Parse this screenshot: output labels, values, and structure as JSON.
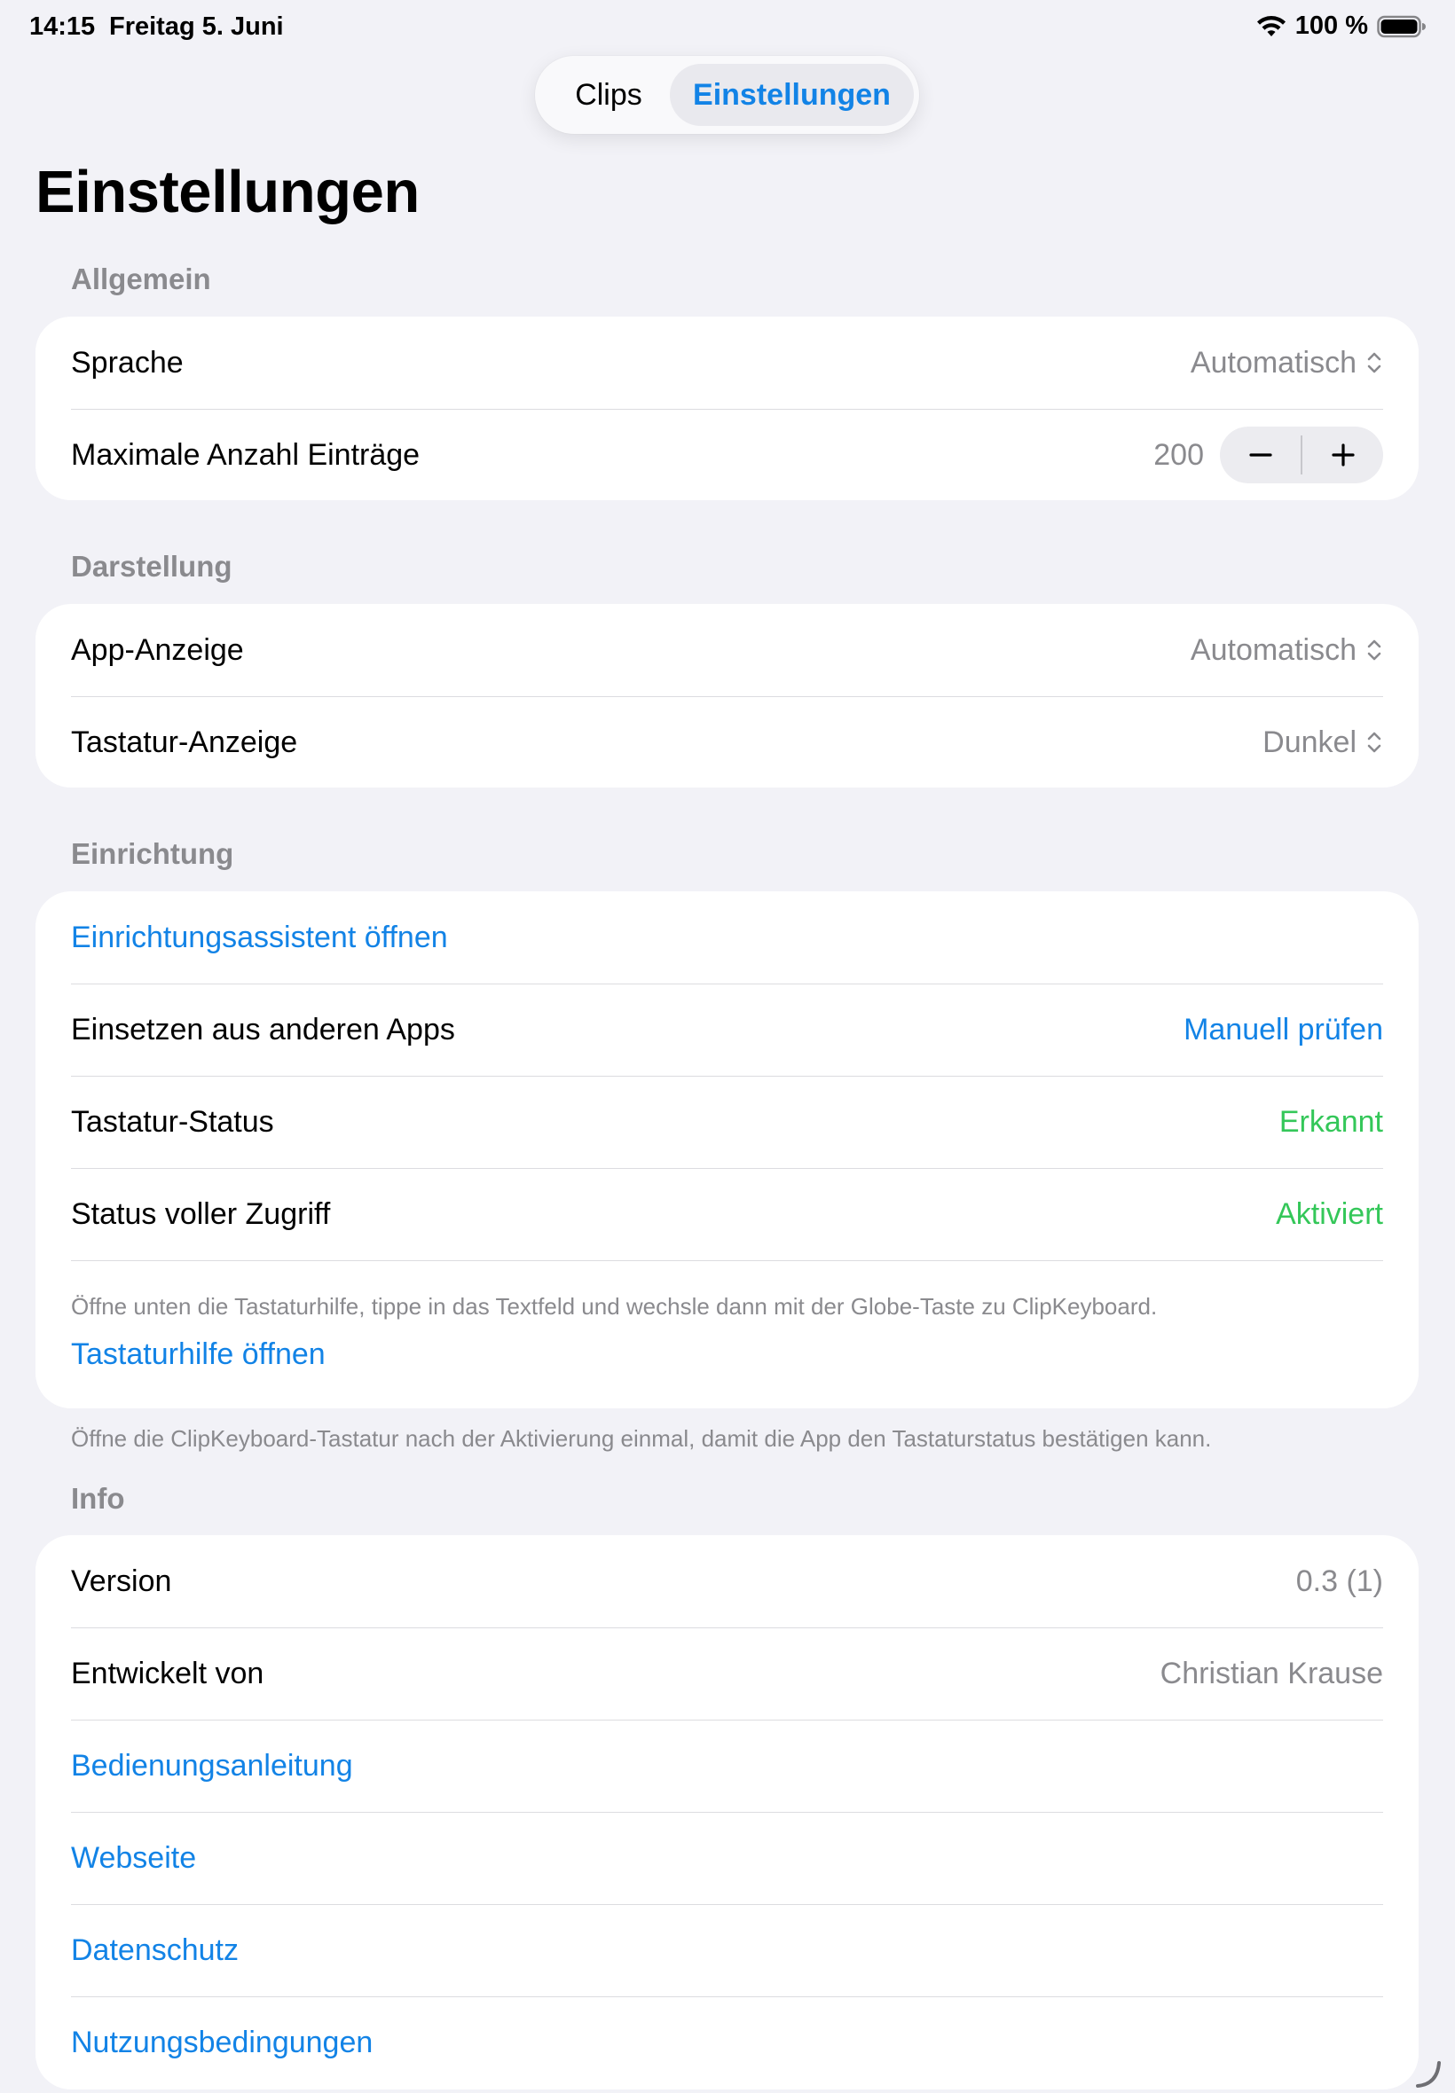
{
  "status_bar": {
    "time": "14:15",
    "date": "Freitag 5. Juni",
    "battery_text": "100 %",
    "battery_level_percent": 100,
    "icons": [
      "wifi-icon",
      "battery-icon"
    ]
  },
  "segmented_control": {
    "items": [
      "Clips",
      "Einstellungen"
    ],
    "selected": "Einstellungen"
  },
  "page": {
    "title": "Einstellungen"
  },
  "sections": {
    "allgemein": {
      "header": "Allgemein",
      "rows": {
        "sprache": {
          "label": "Sprache",
          "value": "Automatisch"
        },
        "max_entries": {
          "label": "Maximale Anzahl Einträge",
          "value": "200"
        }
      }
    },
    "darstellung": {
      "header": "Darstellung",
      "rows": {
        "app_anzeige": {
          "label": "App-Anzeige",
          "value": "Automatisch"
        },
        "tastatur_anzeige": {
          "label": "Tastatur-Anzeige",
          "value": "Dunkel"
        }
      }
    },
    "einrichtung": {
      "header": "Einrichtung",
      "rows": {
        "assistant": {
          "label": "Einrichtungsassistent öffnen"
        },
        "paste": {
          "label": "Einsetzen aus anderen Apps",
          "value": "Manuell prüfen"
        },
        "keyboard_status": {
          "label": "Tastatur-Status",
          "value": "Erkannt"
        },
        "full_access": {
          "label": "Status voller Zugriff",
          "value": "Aktiviert"
        }
      },
      "hint": "Öffne unten die Tastaturhilfe, tippe in das Textfeld und wechsle dann mit der Globe-Taste zu ClipKeyboard.",
      "help_link": "Tastaturhilfe öffnen",
      "footer": "Öffne die ClipKeyboard-Tastatur nach der Aktivierung einmal, damit die App den Tastaturstatus bestätigen kann."
    },
    "info": {
      "header": "Info",
      "rows": {
        "version": {
          "label": "Version",
          "value": "0.3 (1)"
        },
        "developer": {
          "label": "Entwickelt von",
          "value": "Christian Krause"
        },
        "manual": {
          "label": "Bedienungsanleitung"
        },
        "website": {
          "label": "Webseite"
        },
        "privacy": {
          "label": "Datenschutz"
        },
        "terms": {
          "label": "Nutzungsbedingungen"
        }
      }
    }
  },
  "colors": {
    "background": "#f2f2f7",
    "card": "#ffffff",
    "accent_blue": "#1283e6",
    "status_green": "#34c759",
    "secondary_text": "#8a8a8e"
  }
}
